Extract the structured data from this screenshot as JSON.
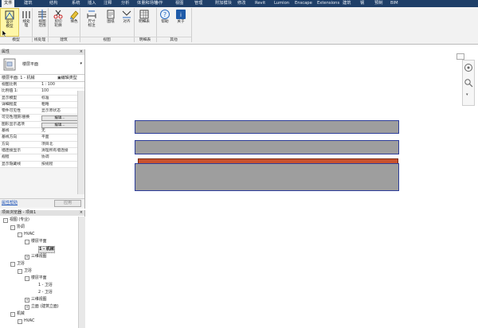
{
  "tabs": [
    "文件",
    "建筑",
    "结构",
    "系统",
    "插入",
    "注释",
    "分析",
    "体量和场地",
    "协作",
    "视图",
    "管理",
    "附加模块",
    "修改",
    "Revit",
    "Lumion",
    "Enscape",
    "Extensions",
    "建筑",
    "钢",
    "预制",
    "BIM"
  ],
  "active_tab": "文件",
  "ribbon": {
    "tools": [
      {
        "name": "design-model-tool",
        "label1": "设计",
        "label2": "模型",
        "icon": "design-icon"
      },
      {
        "name": "line-tool",
        "label1": "线处",
        "label2": "理",
        "icon": "linework-icon"
      },
      {
        "name": "view-tool",
        "label1": "视图",
        "label2": "范围",
        "icon": "view-range-icon"
      },
      {
        "name": "clip-tool",
        "label1": "剪切",
        "label2": "轮廓",
        "icon": "scissors-icon"
      },
      {
        "name": "paint-tool",
        "label1": "填色",
        "label2": "",
        "icon": "paint-icon"
      },
      {
        "name": "dim-tool",
        "label1": "尺寸",
        "label2": "标注",
        "icon": "dimension-icon"
      },
      {
        "name": "sheet-tool",
        "label1": "图纸",
        "label2": "",
        "icon": "sheet-icon"
      },
      {
        "name": "align-tool",
        "label1": "对齐",
        "label2": "",
        "icon": "align-icon"
      },
      {
        "name": "schedule-tool",
        "label1": "明细表",
        "label2": "",
        "icon": "schedule-icon"
      },
      {
        "name": "help-tool",
        "label1": "帮助",
        "label2": "",
        "icon": "help-icon"
      },
      {
        "name": "about-tool",
        "label1": "关于",
        "label2": "",
        "icon": "about-icon"
      }
    ],
    "groups": [
      "模型",
      "线处理",
      "建筑",
      "视图",
      "明细表",
      "其他"
    ]
  },
  "properties": {
    "title": "属性",
    "type_name": "楼层平面",
    "selector": "楼层平面: 1 - 机械",
    "edit_type": "编辑类型",
    "rows": [
      {
        "k": "视图比例",
        "v": "1 : 100"
      },
      {
        "k": "比例值 1:",
        "v": "100"
      },
      {
        "k": "显示模型",
        "v": "标准"
      },
      {
        "k": "详细程度",
        "v": "粗略"
      },
      {
        "k": "零件可见性",
        "v": "显示原状态"
      },
      {
        "k": "可见性/图形替换",
        "v": "编辑...",
        "btn": true
      },
      {
        "k": "图形显示选项",
        "v": "编辑...",
        "btn": true
      },
      {
        "k": "基线",
        "v": "无"
      },
      {
        "k": "基线方向",
        "v": "平面"
      },
      {
        "k": "方向",
        "v": "项目北"
      },
      {
        "k": "墙连接显示",
        "v": "清理所有墙连接"
      },
      {
        "k": "规程",
        "v": "协调"
      },
      {
        "k": "显示隐藏线",
        "v": "按规程"
      }
    ],
    "help_link": "属性帮助",
    "apply_button": "应用"
  },
  "browser": {
    "title": "项目浏览器 - 项目1",
    "items": [
      {
        "text": "视图 (专业)",
        "level": 0,
        "box": "-"
      },
      {
        "text": "协调",
        "level": 1,
        "box": "-"
      },
      {
        "text": "HVAC",
        "level": 2,
        "box": "-"
      },
      {
        "text": "楼层平面",
        "level": 3,
        "box": "-"
      },
      {
        "text": "1 - 机械",
        "level": 4,
        "box": "",
        "selected": true
      },
      {
        "text": "三维视图",
        "level": 3,
        "box": "+"
      },
      {
        "text": "卫浴",
        "level": 1,
        "box": "-"
      },
      {
        "text": "卫浴",
        "level": 2,
        "box": "-"
      },
      {
        "text": "楼层平面",
        "level": 3,
        "box": "-"
      },
      {
        "text": "1 - 卫浴",
        "level": 4,
        "box": ""
      },
      {
        "text": "2 - 卫浴",
        "level": 4,
        "box": ""
      },
      {
        "text": "三维视图",
        "level": 3,
        "box": "+"
      },
      {
        "text": "立面 (建筑立面)",
        "level": 3,
        "box": "+"
      },
      {
        "text": "机械",
        "level": 1,
        "box": "-"
      },
      {
        "text": "HVAC",
        "level": 2,
        "box": "-"
      }
    ]
  },
  "colors": {
    "wall_fill": "#9e9e9e",
    "wall_outline": "#2d3d9a",
    "slab_fill": "#c8522e",
    "tabbar": "#1f3f68",
    "highlight": "#fff7a8"
  }
}
